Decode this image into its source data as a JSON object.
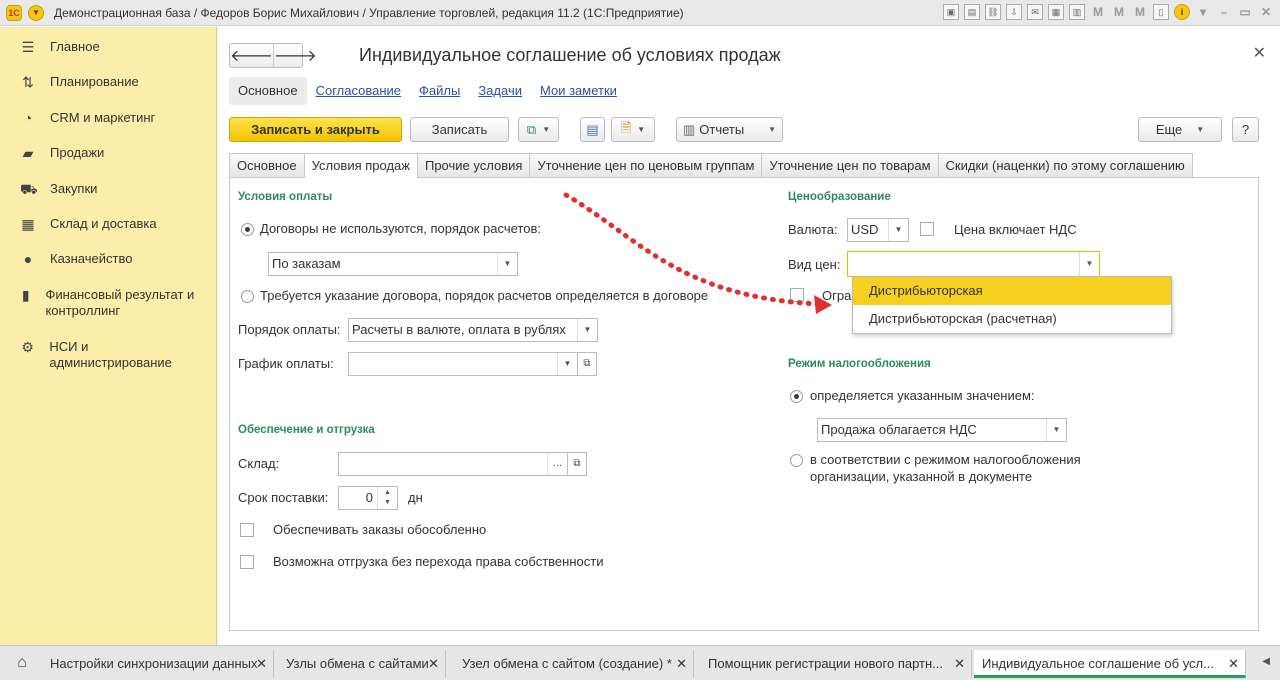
{
  "window": {
    "title": "Демонстрационная база / Федоров Борис Михайлович / Управление торговлей, редакция 11.2  (1С:Предприятие)",
    "logo": "1С"
  },
  "sidebar": {
    "items": [
      {
        "label": "Главное",
        "icon": "menu-icon"
      },
      {
        "label": "Планирование",
        "icon": "planning-icon"
      },
      {
        "label": "CRM и маркетинг",
        "icon": "crm-icon"
      },
      {
        "label": "Продажи",
        "icon": "sales-icon"
      },
      {
        "label": "Закупки",
        "icon": "purchases-icon"
      },
      {
        "label": "Склад и доставка",
        "icon": "warehouse-icon"
      },
      {
        "label": "Казначейство",
        "icon": "treasury-icon"
      },
      {
        "label": "Финансовый результат и контроллинг",
        "icon": "chart-icon"
      },
      {
        "label": "НСИ и администрирование",
        "icon": "gear-icon"
      }
    ]
  },
  "doc": {
    "title": "Индивидуальное соглашение об условиях продаж"
  },
  "section_tabs": [
    "Основное",
    "Согласование",
    "Файлы",
    "Задачи",
    "Мои заметки"
  ],
  "toolbar": {
    "save_close": "Записать и закрыть",
    "save": "Записать",
    "reports": "Отчеты",
    "more": "Еще",
    "help": "?"
  },
  "tabs": [
    "Основное",
    "Условия продаж",
    "Прочие условия",
    "Уточнение цен по ценовым группам",
    "Уточнение цен по товарам",
    "Скидки (наценки) по этому соглашению"
  ],
  "payment": {
    "group": "Условия оплаты",
    "radio1": "Договоры не используются, порядок расчетов:",
    "order_value": "По заказам",
    "radio2": "Требуется указание договора, порядок расчетов определяется в договоре",
    "order_label": "Порядок оплаты:",
    "order_payment_value": "Расчеты в валюте, оплата в рублях",
    "schedule_label": "График оплаты:",
    "schedule_value": ""
  },
  "shipping": {
    "group": "Обеспечение и отгрузка",
    "warehouse_label": "Склад:",
    "warehouse_value": "",
    "term_label": "Срок поставки:",
    "term_value": "0",
    "term_unit": "дн",
    "chk1": "Обеспечивать заказы обособленно",
    "chk2": "Возможна отгрузка без перехода права собственности"
  },
  "pricing": {
    "group": "Ценообразование",
    "currency_label": "Валюта:",
    "currency_value": "USD",
    "vat_included": "Цена включает НДС",
    "price_type_label": "Вид цен:",
    "price_type_value": "",
    "hidden_chk_label": "Огра"
  },
  "dropdown": {
    "options": [
      "Дистрибьюторская",
      "Дистрибьюторская (расчетная)"
    ],
    "selected": "Дистрибьюторская"
  },
  "tax": {
    "group": "Режим налогообложения",
    "radio1": "определяется указанным значением:",
    "value": "Продажа облагается НДС",
    "radio2_line1": "в соответствии с режимом налогообложения",
    "radio2_line2": "организации, указанной в документе"
  },
  "taskbar": {
    "items": [
      "Настройки синхронизации данных",
      "Узлы обмена с сайтами",
      "Узел обмена с сайтом (создание) *",
      "Помощник регистрации нового партн...",
      "Индивидуальное соглашение об усл..."
    ]
  },
  "colors": {
    "sidebar": "#fbeeaa",
    "accent": "#f3c300",
    "group_heading": "#2e8b57",
    "arrow": "#e03030"
  }
}
